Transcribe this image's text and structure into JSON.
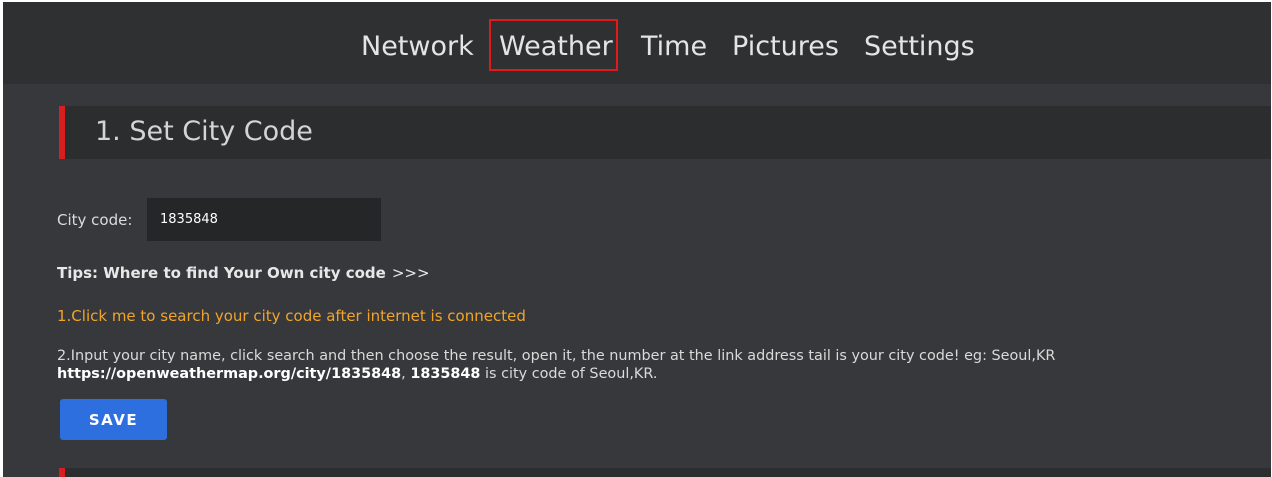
{
  "nav": {
    "items": [
      {
        "label": "Network"
      },
      {
        "label": "Weather"
      },
      {
        "label": "Time"
      },
      {
        "label": "Pictures"
      },
      {
        "label": "Settings"
      }
    ],
    "active": "Weather"
  },
  "section": {
    "title": "1. Set City Code"
  },
  "city_code": {
    "label": "City code:",
    "value": "1835848"
  },
  "tips": {
    "label": "Tips:  Where to find Your Own city code",
    "arrows": ">>>"
  },
  "search_link": {
    "label": "1.Click me to search your city code after internet is connected"
  },
  "instructions": {
    "text": "2.Input your city name, click search and then choose the result, open it, the number at the link address tail is your city code! eg: Seoul,KR",
    "url": "https://openweathermap.org/city/1835848",
    "sep": ", ",
    "code": "1835848",
    "suffix": " is city code of Seoul,KR."
  },
  "save_button": {
    "label": "SAVE"
  },
  "colors": {
    "nav_bg": "#2f3032",
    "content_bg": "#37383b",
    "accent_red": "#d81e1e",
    "link_orange": "#f0a52a",
    "button_blue": "#2e6fe0"
  }
}
